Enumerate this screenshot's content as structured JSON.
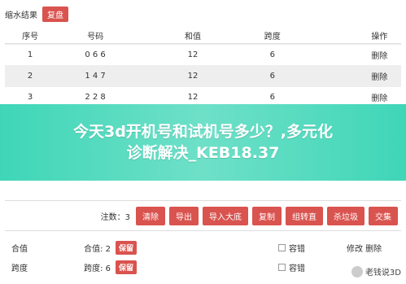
{
  "topbar": {
    "title": "缩水结果",
    "restore_label": "复盘"
  },
  "table": {
    "headers": [
      "序号",
      "号码",
      "和值",
      "跨度",
      "操作"
    ],
    "rows": [
      {
        "index": "1",
        "number": "0 6 6",
        "sum": "12",
        "span": "6",
        "action": "删除"
      },
      {
        "index": "2",
        "number": "1 4 7",
        "sum": "12",
        "span": "6",
        "action": "删除"
      },
      {
        "index": "3",
        "number": "2 2 8",
        "sum": "12",
        "span": "6",
        "action": "删除"
      }
    ]
  },
  "banner": {
    "line1": "今天3d开机号和试机号多少？,多元化",
    "line2": "诊断解决_KEB18.37"
  },
  "panel": {
    "count_label": "注数：3",
    "buttons": [
      "清除",
      "导出",
      "导入大底",
      "复制",
      "组转直",
      "杀垃圾",
      "交集"
    ]
  },
  "settings": {
    "rows": [
      {
        "label": "合值",
        "value": "合值: 2",
        "keep": "保留",
        "tol": "容错",
        "ops": "修改 删除"
      },
      {
        "label": "跨度",
        "value": "跨度: 6",
        "keep": "保留",
        "tol": "容错",
        "ops": ""
      }
    ]
  },
  "watermark": "老钱说3D"
}
